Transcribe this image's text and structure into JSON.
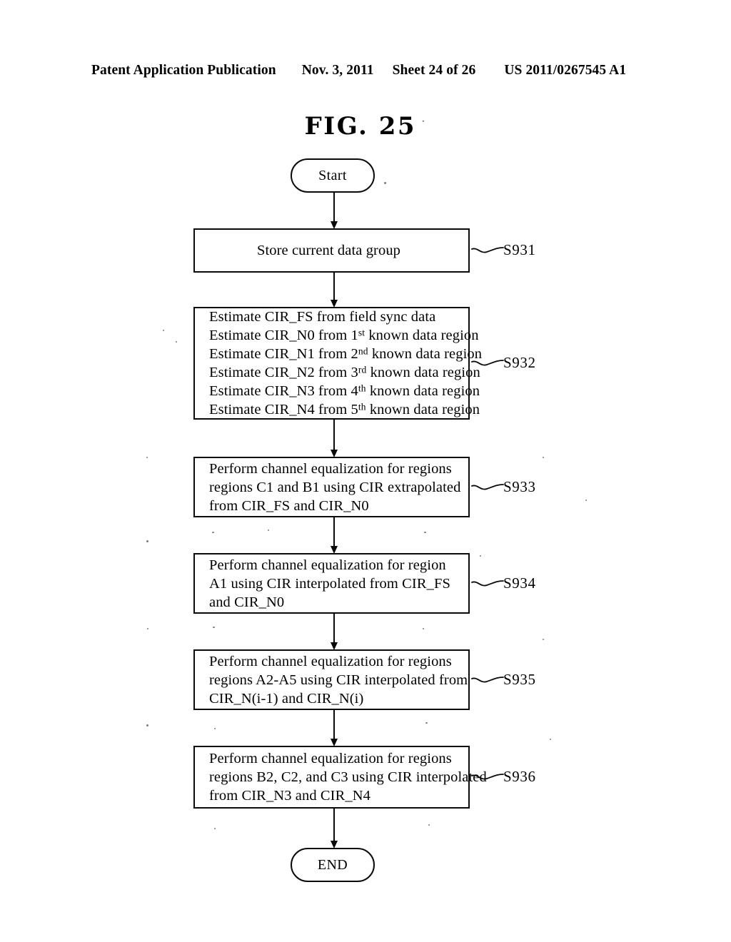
{
  "header": {
    "publication": "Patent Application Publication",
    "date": "Nov. 3, 2011",
    "sheet": "Sheet 24 of 26",
    "doc_number": "US 2011/0267545 A1"
  },
  "figure": {
    "title": "FIG. 25"
  },
  "flowchart": {
    "start_label": "Start",
    "end_label": "END",
    "steps": [
      {
        "ref": "S931",
        "align": "center",
        "lines": [
          [
            {
              "t": "Store current data group"
            }
          ]
        ]
      },
      {
        "ref": "S932",
        "align": "left",
        "lines": [
          [
            {
              "t": "Estimate CIR_FS from field sync data"
            }
          ],
          [
            {
              "t": "Estimate CIR_N0 from 1"
            },
            {
              "t": "st",
              "sup": true
            },
            {
              "t": " known data region"
            }
          ],
          [
            {
              "t": "Estimate CIR_N1 from 2"
            },
            {
              "t": "nd",
              "sup": true
            },
            {
              "t": " known data region"
            }
          ],
          [
            {
              "t": "Estimate CIR_N2 from 3"
            },
            {
              "t": "rd",
              "sup": true
            },
            {
              "t": " known data region"
            }
          ],
          [
            {
              "t": "Estimate CIR_N3 from 4"
            },
            {
              "t": "th",
              "sup": true
            },
            {
              "t": " known data region"
            }
          ],
          [
            {
              "t": "Estimate CIR_N4 from 5"
            },
            {
              "t": "th",
              "sup": true
            },
            {
              "t": " known data region"
            }
          ]
        ]
      },
      {
        "ref": "S933",
        "align": "left",
        "lines": [
          [
            {
              "t": "Perform channel equalization for regions"
            }
          ],
          [
            {
              "t": "regions C1 and B1 using CIR extrapolated"
            }
          ],
          [
            {
              "t": "from CIR_FS and CIR_N0"
            }
          ]
        ]
      },
      {
        "ref": "S934",
        "align": "left",
        "lines": [
          [
            {
              "t": "Perform channel equalization for region"
            }
          ],
          [
            {
              "t": "A1 using CIR interpolated from CIR_FS"
            }
          ],
          [
            {
              "t": "and CIR_N0"
            }
          ]
        ]
      },
      {
        "ref": "S935",
        "align": "left",
        "lines": [
          [
            {
              "t": "Perform channel equalization for regions"
            }
          ],
          [
            {
              "t": "regions A2-A5 using CIR interpolated from"
            }
          ],
          [
            {
              "t": "CIR_N(i-1) and CIR_N(i)"
            }
          ]
        ]
      },
      {
        "ref": "S936",
        "align": "left",
        "lines": [
          [
            {
              "t": "Perform channel equalization for regions"
            }
          ],
          [
            {
              "t": "regions B2, C2, and C3 using CIR interpolated"
            }
          ],
          [
            {
              "t": "from CIR_N3 and CIR_N4"
            }
          ]
        ]
      }
    ]
  }
}
